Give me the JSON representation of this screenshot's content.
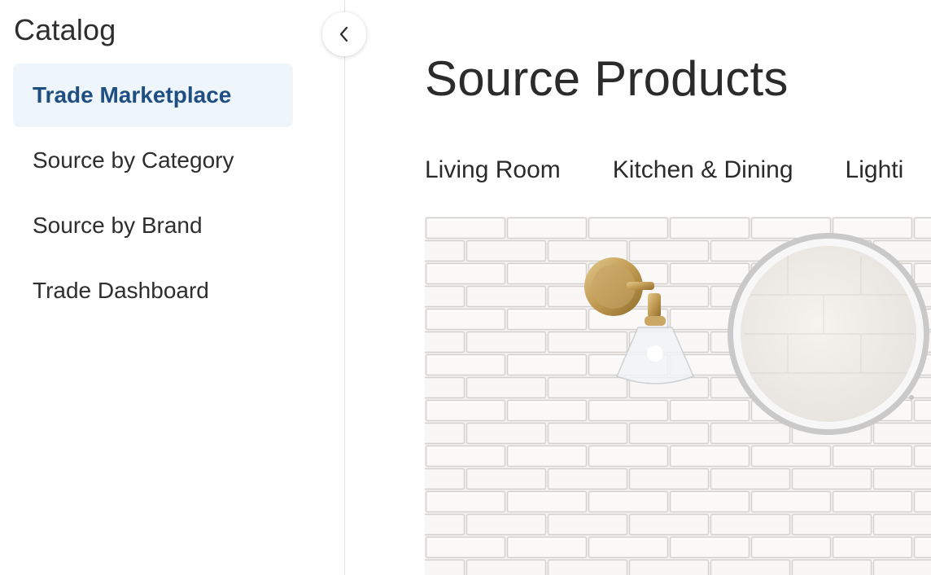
{
  "sidebar": {
    "title": "Catalog",
    "items": [
      {
        "label": "Trade Marketplace",
        "active": true
      },
      {
        "label": "Source by Category",
        "active": false
      },
      {
        "label": "Source by Brand",
        "active": false
      },
      {
        "label": "Trade Dashboard",
        "active": false
      }
    ],
    "collapse_icon": "chevron-left-icon"
  },
  "main": {
    "title": "Source Products",
    "tabs": [
      {
        "label": "Living Room"
      },
      {
        "label": "Kitchen & Dining"
      },
      {
        "label": "Lighti"
      }
    ]
  },
  "colors": {
    "active_text": "#1f4f82",
    "active_bg": "#eef5fb",
    "text": "#2b2b2b"
  }
}
